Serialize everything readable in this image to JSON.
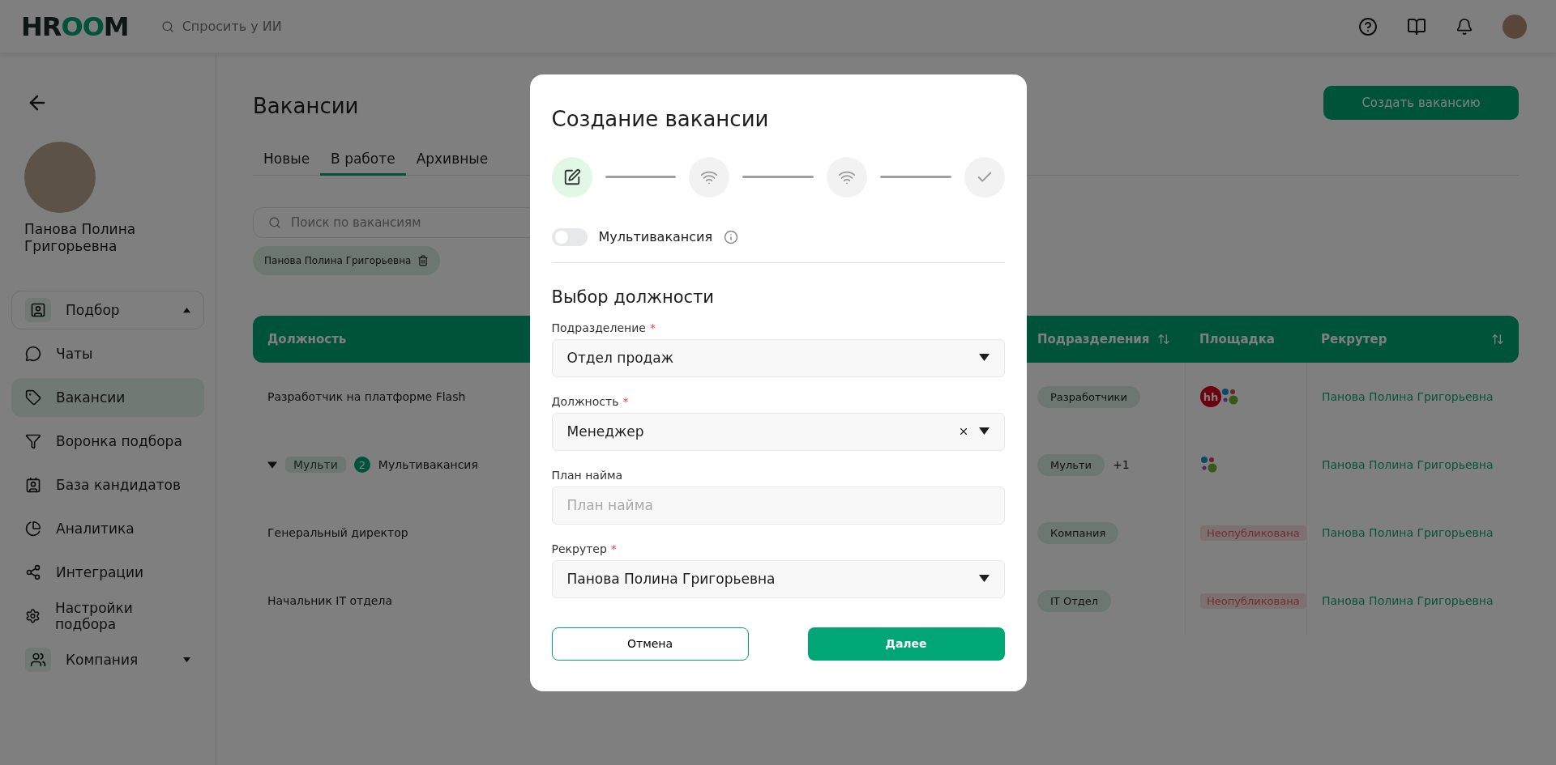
{
  "header": {
    "logo": "HROOM",
    "ask_placeholder": "Спросить у ИИ"
  },
  "sidebar": {
    "user_name": "Панова Полина Григорьевна",
    "items": [
      {
        "kind": "group",
        "label": "Подбор",
        "expanded": true,
        "selected": false
      },
      {
        "kind": "link",
        "label": "Чаты",
        "selected": false
      },
      {
        "kind": "link",
        "label": "Вакансии",
        "selected": true
      },
      {
        "kind": "link",
        "label": "Воронка подбора",
        "selected": false
      },
      {
        "kind": "link",
        "label": "База кандидатов",
        "selected": false
      },
      {
        "kind": "link",
        "label": "Аналитика",
        "selected": false
      },
      {
        "kind": "link",
        "label": "Интеграции",
        "selected": false
      },
      {
        "kind": "link",
        "label": "Настройки подбора",
        "selected": false
      },
      {
        "kind": "group",
        "label": "Компания",
        "expanded": false,
        "selected": false
      }
    ]
  },
  "page": {
    "title": "Вакансии",
    "create_button": "Создать вакансию",
    "tabs": [
      {
        "label": "Новые",
        "selected": false
      },
      {
        "label": "В работе",
        "selected": true
      },
      {
        "label": "Архивные",
        "selected": false
      }
    ],
    "search_placeholder": "Поиск по вакансиям",
    "filter_chip": "Панова Полина Григорьевна"
  },
  "table": {
    "columns": [
      {
        "label": "Должность"
      },
      {
        "label": "Подразделения",
        "sortable": true
      },
      {
        "label": "Площадка",
        "sortable": false
      },
      {
        "label": "Рекрутер",
        "sortable": true
      }
    ],
    "rows": [
      {
        "kind": "single",
        "title": "Разработчик на платформе Flash",
        "department": "Разработчики",
        "platform": {
          "kind": "logos",
          "logos": [
            {
              "kind": "hh",
              "label": "hh"
            },
            {
              "kind": "dots"
            }
          ]
        },
        "recruiter": "Панова Полина Григорьевна"
      },
      {
        "kind": "multi",
        "expanded": true,
        "tag": "Мульти",
        "count": "2",
        "title": "Мультивакансия",
        "department": "Мульти",
        "department_extra": "+1",
        "platform": {
          "kind": "logos",
          "logos": [
            {
              "kind": "dots"
            }
          ]
        },
        "recruiter": "Панова Полина Григорьевна"
      },
      {
        "kind": "single",
        "title": "Генеральный директор",
        "department": "Компания",
        "platform": {
          "kind": "status",
          "label": "Неопубликована"
        },
        "recruiter": "Панова Полина Григорьевна"
      },
      {
        "kind": "single",
        "title": "Начальник IT отдела",
        "department": "IT Отдел",
        "platform": {
          "kind": "status",
          "label": "Неопубликована"
        },
        "recruiter": "Панова Полина Григорьевна"
      }
    ]
  },
  "modal": {
    "title": "Создание вакансии",
    "steps": [
      {
        "selected": true
      },
      {
        "selected": false
      },
      {
        "selected": false
      },
      {
        "selected": false
      }
    ],
    "multi_toggle": {
      "label": "Мультивакансия",
      "on": false
    },
    "section_title": "Выбор должности",
    "fields": [
      {
        "kind": "select",
        "label": "Подразделение",
        "required_mark": "*",
        "value": "Отдел продаж",
        "clearable": false
      },
      {
        "kind": "select",
        "label": "Должность",
        "required_mark": "*",
        "value": "Менеджер",
        "clearable": true
      },
      {
        "kind": "input",
        "label": "План найма",
        "placeholder": "План найма"
      },
      {
        "kind": "select",
        "label": "Рекрутер",
        "required_mark": "*",
        "value": "Панова Полина Григорьевна",
        "clearable": false
      }
    ],
    "cancel_button": "Отмена",
    "next_button": "Далее"
  }
}
